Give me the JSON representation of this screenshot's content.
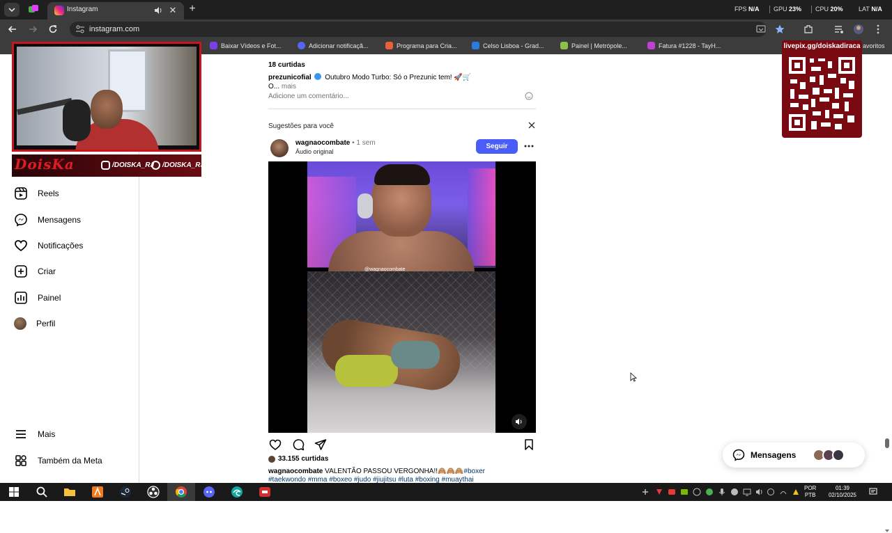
{
  "browser": {
    "tab_title": "Instagram",
    "url": "instagram.com",
    "perf": {
      "fps_label": "FPS",
      "fps_value": "N/A",
      "gpu_label": "GPU",
      "gpu_value": "23%",
      "cpu_label": "CPU",
      "cpu_value": "20%",
      "lat_label": "LAT",
      "lat_value": "N/A"
    },
    "bookmarks": [
      {
        "label": "Baixar Vídeos e Fot...",
        "color": "#7b3fe4"
      },
      {
        "label": "Adicionar notificaçã...",
        "color": "#5865f2"
      },
      {
        "label": "Programa para Cria...",
        "color": "#e8613c"
      },
      {
        "label": "Celso Lisboa - Grad...",
        "color": "#2a7bde"
      },
      {
        "label": "Painel | Metrópole...",
        "color": "#8bc34a"
      },
      {
        "label": "Fatura #1228 - TayH...",
        "color": "#c040d0"
      }
    ],
    "bookmarks_overflow": "avoritos"
  },
  "sidebar": {
    "items": [
      {
        "label": "Reels",
        "icon": "reels-icon"
      },
      {
        "label": "Mensagens",
        "icon": "messenger-icon"
      },
      {
        "label": "Notificações",
        "icon": "heart-icon"
      },
      {
        "label": "Criar",
        "icon": "plus-square-icon"
      },
      {
        "label": "Painel",
        "icon": "dashboard-icon"
      },
      {
        "label": "Perfil",
        "icon": "avatar"
      }
    ],
    "more_label": "Mais",
    "meta_label": "Também da Meta"
  },
  "feed": {
    "prev_post": {
      "likes": "18 curtidas",
      "username": "prezunicofial",
      "caption": "Outubro Modo Turbo: Só o Prezunic tem! 🚀🛒",
      "caption_cont": "O...",
      "more": "mais",
      "comment_placeholder": "Adicione um comentário..."
    },
    "suggestions_title": "Sugestões para você",
    "post": {
      "username": "wagnaocombate",
      "time": "1 sem",
      "audio": "Áudio original",
      "follow_label": "Seguir",
      "video_watermark": "@wagnaocombate",
      "likes": "33.155 curtidas",
      "caption_user": "wagnaocombate",
      "caption_text": "VALENTÃO PASSOU VERGONHA!!🙈🙈🙈",
      "tags_line1": "#boxer",
      "tags_line2": "#taekwondo #mma #boxeo #judo #jiujitsu #luta #boxing #muaythai"
    }
  },
  "overlay": {
    "banner_logo": "DoisKa",
    "banner_handle1": "/DOISKA_RJ",
    "banner_handle2": "/DOISKA_RJ",
    "qr_title": "livepix.gg/doiskadiraca"
  },
  "messages_pill": {
    "label": "Mensagens"
  },
  "taskbar": {
    "lang_line1": "POR",
    "lang_line2": "PTB",
    "time": "01:39",
    "date": "02/10/2025"
  },
  "colors": {
    "follow_blue": "#4a5df9",
    "overlay_red": "#c8161e",
    "link_blue": "#00376b"
  }
}
